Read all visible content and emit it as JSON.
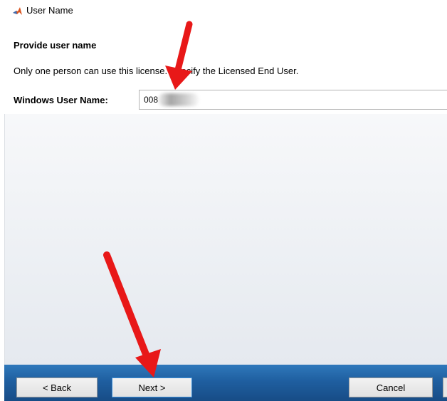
{
  "window": {
    "title": "User Name",
    "icon": "matlab-logo-icon"
  },
  "page": {
    "heading": "Provide user name",
    "description": "Only one person can use this license. Specify the Licensed End User."
  },
  "form": {
    "windows_user_name_label": "Windows User Name:",
    "windows_user_name_value": "008",
    "windows_user_name_value_note": "remaining characters blurred"
  },
  "buttons": {
    "back_label": "< Back",
    "next_label": "Next >",
    "cancel_label": "Cancel"
  },
  "annotations": {
    "arrow_color": "#e81818",
    "arrows": [
      "arrow-to-user-name-field",
      "arrow-to-next-button"
    ]
  },
  "colors": {
    "button_bar": "#1f5fa0",
    "next_button_border": "#3c8fd8"
  }
}
